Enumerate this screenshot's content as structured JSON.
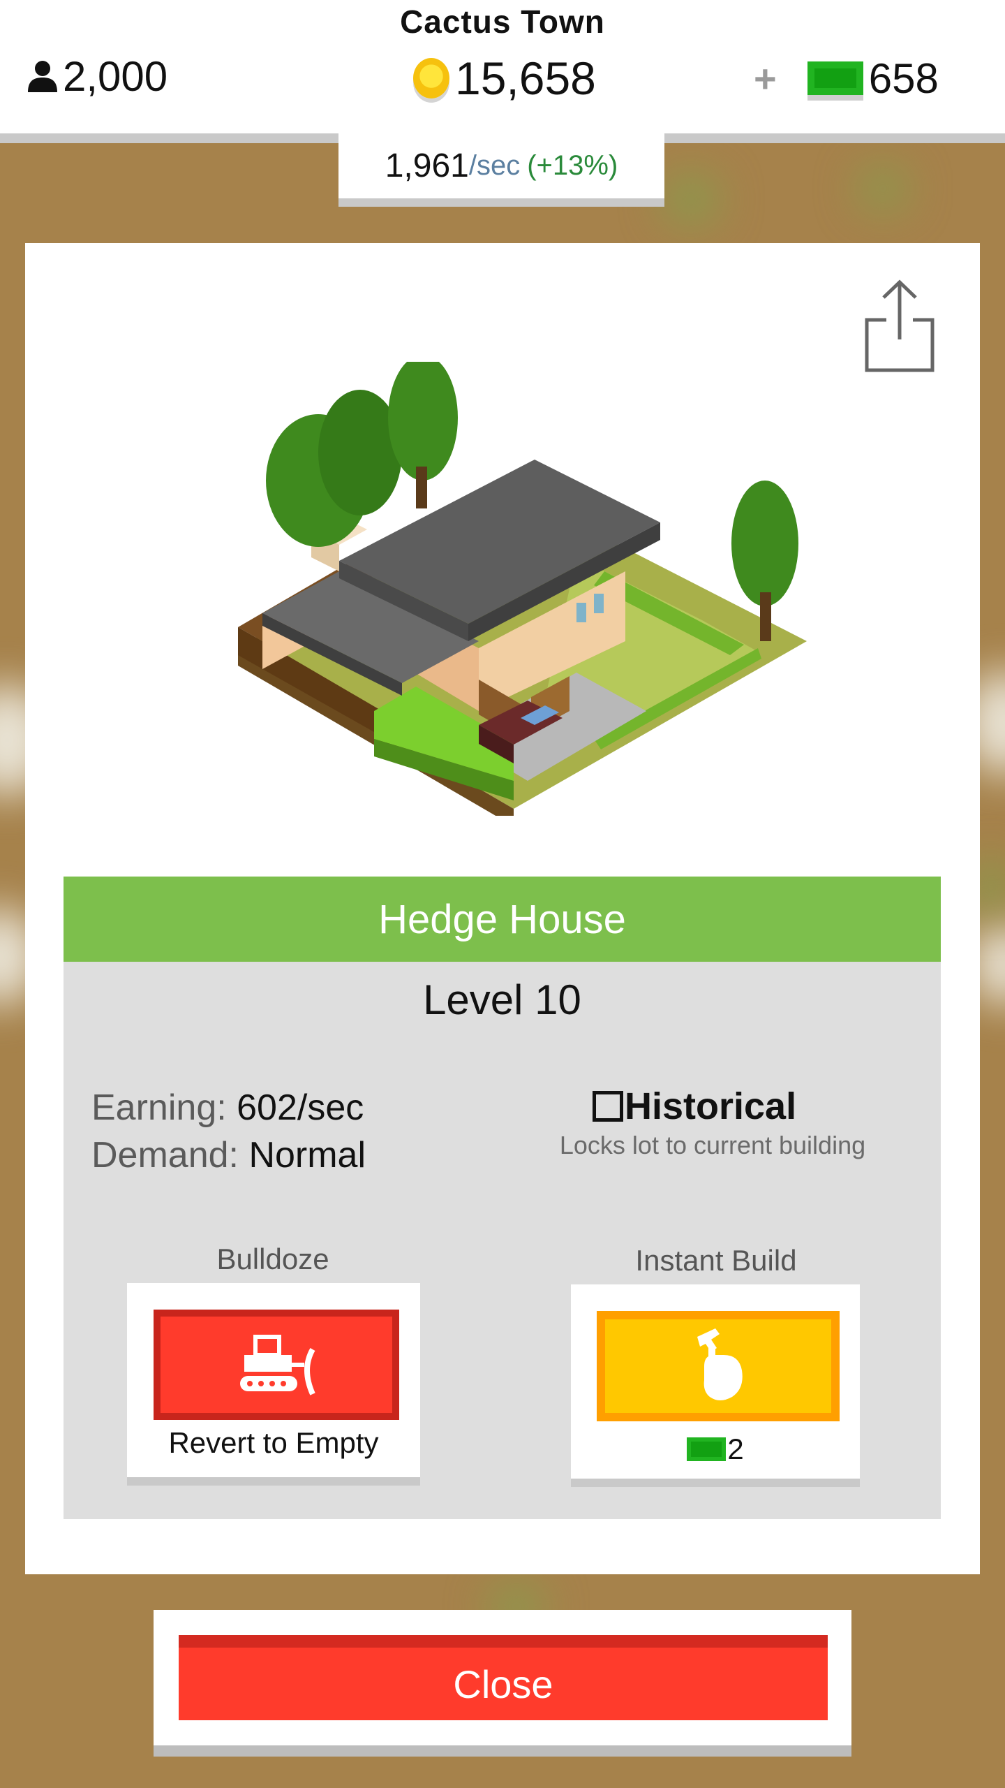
{
  "header": {
    "town_name": "Cactus Town",
    "population": "2,000",
    "coins": "15,658",
    "cash_plus": "+",
    "cash": "658",
    "income_rate": "1,961",
    "income_unit": "/sec",
    "income_bonus": "(+13%)"
  },
  "building": {
    "name": "Hedge House",
    "level": "Level 10",
    "earning_label": "Earning:",
    "earning_value": "602/sec",
    "demand_label": "Demand:",
    "demand_value": "Normal"
  },
  "historical": {
    "label": "Historical",
    "description": "Locks lot to current building",
    "checked": false
  },
  "actions": {
    "bulldoze_label": "Bulldoze",
    "bulldoze_button_text": "Revert to Empty",
    "instant_build_label": "Instant Build",
    "instant_build_cost": "2"
  },
  "close_label": "Close",
  "icons": {
    "population": "person-icon",
    "coins": "coin-icon",
    "cash": "cash-bill-icon",
    "share": "share-icon",
    "bulldoze": "bulldozer-icon",
    "instant_build": "hammer-hand-icon"
  },
  "colors": {
    "name_bar": "#7dbf4c",
    "bulldoze": "#ff3b2c",
    "instant_build": "#ffc800",
    "close": "#ff3b2c",
    "cash": "#21b421",
    "coin": "#f6c10e"
  }
}
